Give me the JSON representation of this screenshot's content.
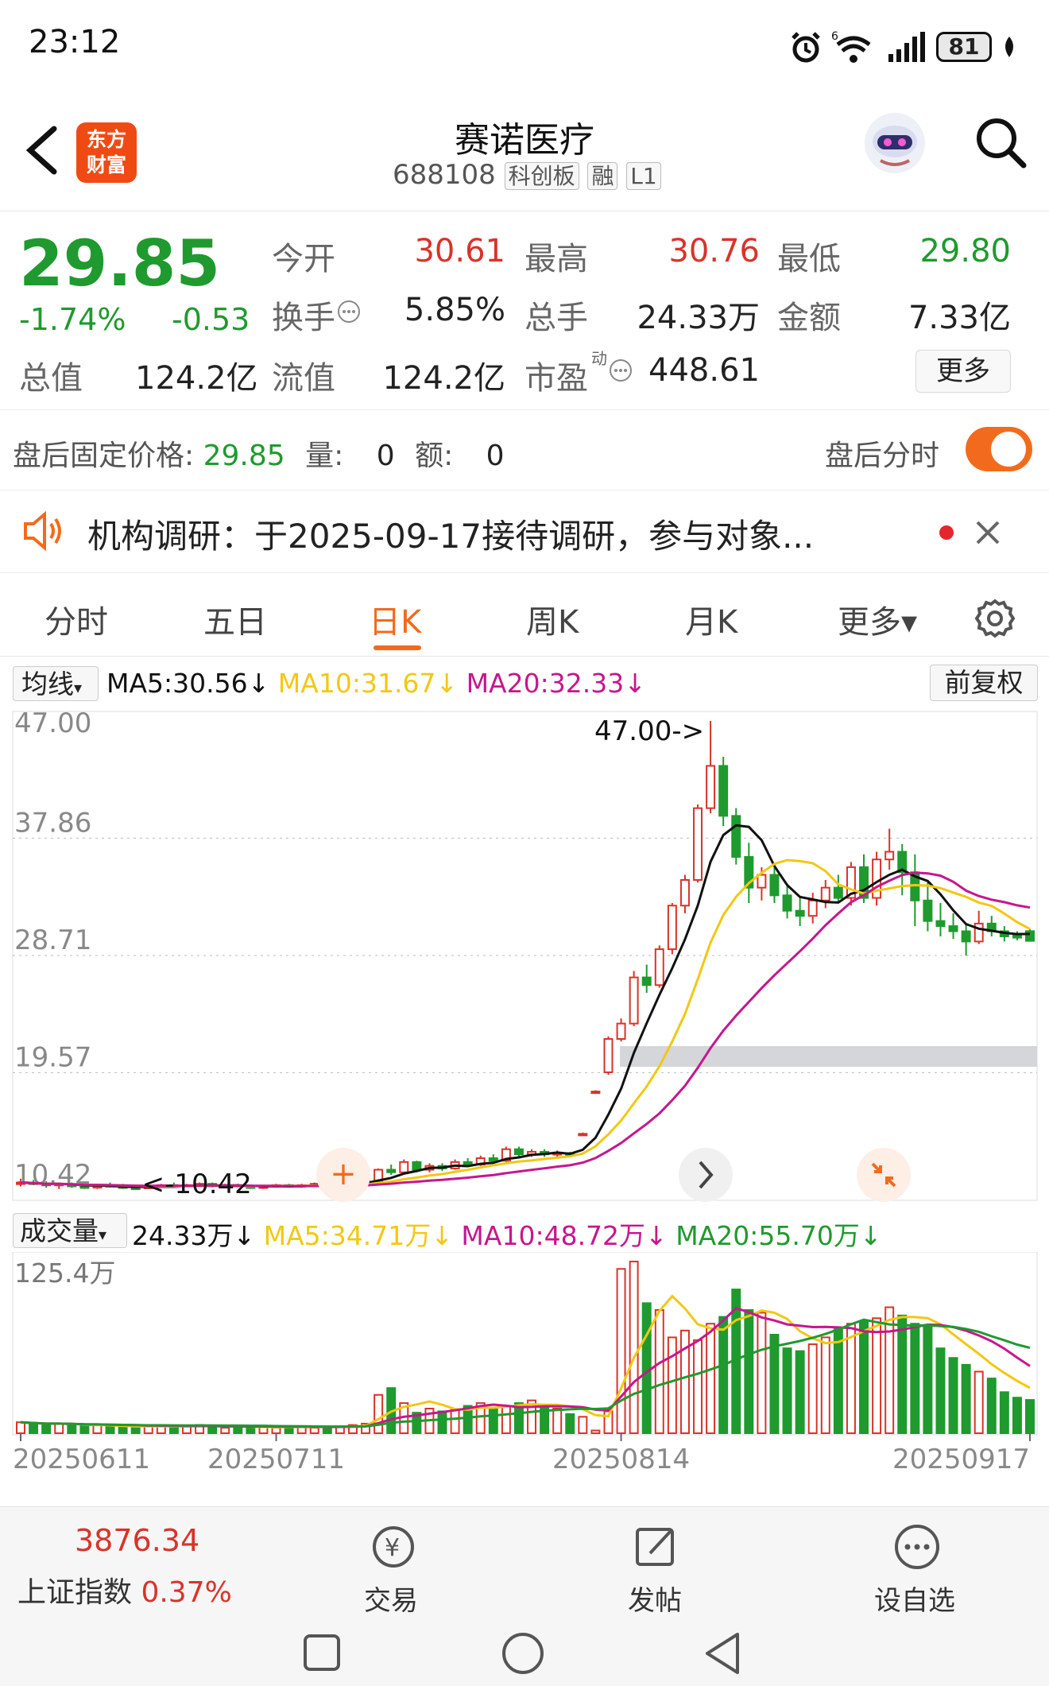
{
  "status_bar": {
    "time": "23:12",
    "battery": "81"
  },
  "header": {
    "logo_top": "东方",
    "logo_bottom": "财富",
    "stock_name": "赛诺医疗",
    "stock_code": "688108",
    "tags": [
      "科创板",
      "融",
      "L1"
    ]
  },
  "quote": {
    "price": "29.85",
    "change_pct": "-1.74%",
    "change": "-0.53",
    "open_label": "今开",
    "open": "30.61",
    "high_label": "最高",
    "high": "30.76",
    "low_label": "最低",
    "low": "29.80",
    "turnover_label": "换手",
    "turnover": "5.85%",
    "volume_label": "总手",
    "volume": "24.33万",
    "amount_label": "金额",
    "amount": "7.33亿",
    "mcap_label": "总值",
    "mcap": "124.2亿",
    "float_label": "流值",
    "float": "124.2亿",
    "pe_label": "市盈",
    "pe_sup": "动",
    "pe": "448.61",
    "more_button": "更多"
  },
  "after_hours": {
    "price_label": "盘后固定价格:",
    "price": "29.85",
    "vol_label": "量:",
    "vol": "0",
    "amt_label": "额:",
    "amt": "0",
    "intraday_label": "盘后分时",
    "toggle_on": true
  },
  "notice": {
    "text": "机构调研：于2025-09-17接待调研，参与对象..."
  },
  "tabs": {
    "items": [
      "分时",
      "五日",
      "日K",
      "周K",
      "月K",
      "更多▾"
    ],
    "active": "日K"
  },
  "chart_controls": {
    "indicator": "均线",
    "ma5": "MA5:30.56↓",
    "ma10": "MA10:31.67↓",
    "ma20": "MA20:32.33↓",
    "adjust": "前复权",
    "vol_indicator": "成交量",
    "vol_today": "24.33万↓",
    "vol_ma5": "MA5:34.71万↓",
    "vol_ma10": "MA10:48.72万↓",
    "vol_ma20": "MA20:55.70万↓",
    "vol_max_label": "125.4万"
  },
  "colors": {
    "up": "#d9332a",
    "down": "#1f9a2e",
    "ma5": "#111111",
    "ma10": "#f2c811",
    "ma20": "#c7168e",
    "accent": "#f26b1d"
  },
  "chart_data": {
    "type": "candlestick",
    "price_axis_labels": [
      "47.00",
      "37.86",
      "28.71",
      "19.57",
      "10.42"
    ],
    "ylim": [
      10.42,
      47.0
    ],
    "max_marker": "47.00->",
    "min_marker": "<-10.42",
    "x_labels": [
      "20250611",
      "20250711",
      "20250814",
      "20250917"
    ],
    "candles": [
      [
        11.0,
        11.3,
        10.7,
        11.0
      ],
      [
        11.0,
        11.2,
        10.8,
        10.9
      ],
      [
        10.9,
        11.1,
        10.6,
        10.8
      ],
      [
        10.8,
        11.0,
        10.5,
        10.9
      ],
      [
        10.9,
        11.0,
        10.6,
        10.7
      ],
      [
        10.7,
        10.9,
        10.5,
        10.6
      ],
      [
        10.6,
        10.9,
        10.5,
        10.8
      ],
      [
        10.8,
        11.0,
        10.6,
        10.7
      ],
      [
        10.7,
        10.9,
        10.5,
        10.6
      ],
      [
        10.6,
        10.8,
        10.42,
        10.55
      ],
      [
        10.55,
        10.8,
        10.5,
        10.7
      ],
      [
        10.7,
        10.9,
        10.6,
        10.8
      ],
      [
        10.8,
        11.0,
        10.6,
        10.7
      ],
      [
        10.7,
        10.9,
        10.6,
        10.8
      ],
      [
        10.8,
        11.0,
        10.7,
        10.9
      ],
      [
        10.9,
        11.0,
        10.6,
        10.7
      ],
      [
        10.7,
        10.9,
        10.6,
        10.8
      ],
      [
        10.8,
        10.9,
        10.6,
        10.7
      ],
      [
        10.7,
        10.8,
        10.5,
        10.6
      ],
      [
        10.6,
        10.8,
        10.5,
        10.7
      ],
      [
        10.7,
        10.9,
        10.6,
        10.8
      ],
      [
        10.8,
        10.9,
        10.6,
        10.7
      ],
      [
        10.7,
        10.9,
        10.6,
        10.8
      ],
      [
        10.8,
        11.0,
        10.7,
        10.9
      ],
      [
        10.9,
        11.0,
        10.7,
        10.8
      ],
      [
        10.8,
        11.0,
        10.7,
        10.9
      ],
      [
        10.9,
        11.1,
        10.8,
        11.0
      ],
      [
        11.0,
        11.3,
        10.9,
        11.1
      ],
      [
        11.1,
        12.1,
        11.0,
        12.0
      ],
      [
        12.0,
        12.4,
        11.6,
        11.8
      ],
      [
        11.8,
        12.8,
        11.7,
        12.6
      ],
      [
        12.6,
        12.7,
        11.8,
        12.0
      ],
      [
        12.0,
        12.5,
        11.8,
        12.3
      ],
      [
        12.3,
        12.5,
        11.9,
        12.1
      ],
      [
        12.1,
        12.8,
        12.0,
        12.6
      ],
      [
        12.6,
        12.9,
        12.2,
        12.4
      ],
      [
        12.4,
        13.1,
        12.3,
        12.9
      ],
      [
        12.9,
        13.2,
        12.5,
        12.7
      ],
      [
        12.7,
        13.8,
        12.6,
        13.6
      ],
      [
        13.6,
        13.8,
        13.0,
        13.2
      ],
      [
        13.2,
        13.6,
        13.0,
        13.4
      ],
      [
        13.4,
        13.6,
        13.0,
        13.2
      ],
      [
        13.2,
        13.5,
        13.0,
        13.3
      ],
      [
        13.3,
        13.4,
        13.0,
        13.1
      ],
      [
        14.8,
        14.9,
        14.7,
        14.8
      ],
      [
        18.1,
        18.2,
        18.0,
        18.1
      ],
      [
        19.6,
        22.4,
        19.4,
        22.2
      ],
      [
        22.2,
        23.8,
        22.0,
        23.4
      ],
      [
        23.4,
        27.5,
        23.2,
        27.0
      ],
      [
        27.0,
        28.0,
        25.8,
        26.4
      ],
      [
        26.4,
        29.5,
        26.2,
        29.2
      ],
      [
        29.2,
        32.8,
        28.8,
        32.6
      ],
      [
        32.6,
        35.0,
        32.0,
        34.6
      ],
      [
        34.6,
        40.5,
        34.4,
        40.2
      ],
      [
        40.2,
        47.0,
        39.8,
        43.5
      ],
      [
        43.5,
        44.2,
        38.8,
        39.6
      ],
      [
        39.6,
        40.2,
        35.8,
        36.4
      ],
      [
        36.4,
        37.5,
        32.8,
        34.0
      ],
      [
        34.0,
        35.6,
        33.0,
        35.0
      ],
      [
        35.0,
        35.8,
        32.8,
        33.4
      ],
      [
        33.4,
        34.2,
        31.6,
        32.2
      ],
      [
        32.2,
        33.2,
        31.0,
        31.8
      ],
      [
        31.8,
        33.6,
        31.2,
        33.0
      ],
      [
        33.0,
        34.6,
        32.4,
        34.0
      ],
      [
        34.0,
        35.0,
        32.8,
        33.2
      ],
      [
        33.2,
        36.0,
        32.6,
        35.6
      ],
      [
        35.6,
        36.6,
        32.8,
        33.2
      ],
      [
        33.2,
        36.8,
        32.6,
        36.2
      ],
      [
        36.2,
        38.6,
        35.4,
        36.8
      ],
      [
        36.8,
        37.4,
        33.4,
        35.2
      ],
      [
        35.2,
        36.6,
        31.0,
        33.0
      ],
      [
        33.0,
        34.6,
        30.6,
        31.4
      ],
      [
        31.4,
        32.8,
        30.2,
        31.0
      ],
      [
        31.0,
        32.0,
        30.0,
        30.6
      ],
      [
        30.6,
        31.2,
        28.7,
        29.8
      ],
      [
        29.8,
        32.2,
        29.6,
        31.2
      ],
      [
        31.2,
        31.8,
        30.2,
        30.6
      ],
      [
        30.6,
        31.0,
        29.8,
        30.2
      ],
      [
        30.4,
        30.6,
        29.9,
        30.1
      ],
      [
        30.61,
        30.76,
        29.8,
        29.85
      ]
    ],
    "volume_ylim": [
      0,
      125.4
    ],
    "volumes": [
      8,
      7,
      6,
      7,
      6,
      5,
      6,
      5,
      5,
      4,
      5,
      6,
      5,
      5,
      6,
      5,
      4,
      5,
      4,
      5,
      4,
      5,
      5,
      4,
      5,
      5,
      6,
      7,
      28,
      33,
      22,
      15,
      18,
      16,
      17,
      20,
      22,
      18,
      20,
      22,
      24,
      20,
      18,
      14,
      12,
      2,
      16,
      120,
      125.4,
      95,
      90,
      70,
      75,
      68,
      80,
      85,
      105,
      90,
      88,
      72,
      62,
      60,
      65,
      70,
      76,
      80,
      82,
      84,
      92,
      86,
      80,
      78,
      62,
      55,
      50,
      45,
      40,
      30,
      26,
      24.33
    ]
  }
}
